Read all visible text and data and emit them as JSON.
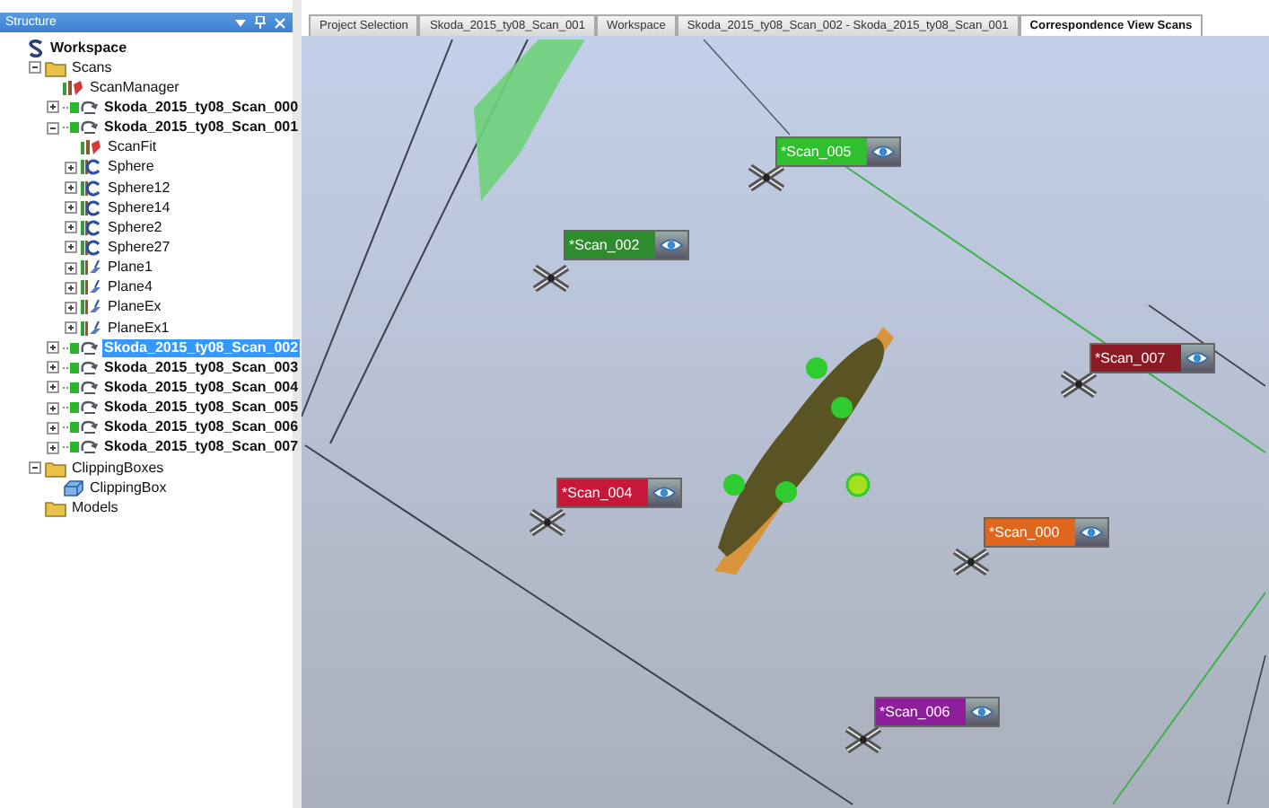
{
  "panel": {
    "title": "Structure"
  },
  "tree": [
    {
      "label": "Workspace",
      "kind": "workspace",
      "selected": false,
      "children": [
        {
          "label": "Scans",
          "kind": "folder",
          "expanded": true,
          "selected": false,
          "children": [
            {
              "label": "ScanManager",
              "kind": "manager",
              "selected": false
            },
            {
              "label": "Skoda_2015_ty08_Scan_000",
              "kind": "scan",
              "expanded": false,
              "selected": false
            },
            {
              "label": "Skoda_2015_ty08_Scan_001",
              "kind": "scan",
              "expanded": true,
              "selected": false,
              "children": [
                {
                  "label": "ScanFit",
                  "kind": "manager",
                  "selected": false
                },
                {
                  "label": "Sphere",
                  "kind": "sphere",
                  "expanded": false,
                  "selected": false
                },
                {
                  "label": "Sphere12",
                  "kind": "sphere",
                  "expanded": false,
                  "selected": false
                },
                {
                  "label": "Sphere14",
                  "kind": "sphere",
                  "expanded": false,
                  "selected": false
                },
                {
                  "label": "Sphere2",
                  "kind": "sphere",
                  "expanded": false,
                  "selected": false
                },
                {
                  "label": "Sphere27",
                  "kind": "sphere",
                  "expanded": false,
                  "selected": false
                },
                {
                  "label": "Plane1",
                  "kind": "plane",
                  "expanded": false,
                  "selected": false
                },
                {
                  "label": "Plane4",
                  "kind": "plane",
                  "expanded": false,
                  "selected": false
                },
                {
                  "label": "PlaneEx",
                  "kind": "plane",
                  "expanded": false,
                  "selected": false
                },
                {
                  "label": "PlaneEx1",
                  "kind": "plane",
                  "expanded": false,
                  "selected": false
                }
              ]
            },
            {
              "label": "Skoda_2015_ty08_Scan_002",
              "kind": "scan",
              "expanded": false,
              "selected": true
            },
            {
              "label": "Skoda_2015_ty08_Scan_003",
              "kind": "scan",
              "expanded": false,
              "selected": false
            },
            {
              "label": "Skoda_2015_ty08_Scan_004",
              "kind": "scan",
              "expanded": false,
              "selected": false
            },
            {
              "label": "Skoda_2015_ty08_Scan_005",
              "kind": "scan",
              "expanded": false,
              "selected": false
            },
            {
              "label": "Skoda_2015_ty08_Scan_006",
              "kind": "scan",
              "expanded": false,
              "selected": false
            },
            {
              "label": "Skoda_2015_ty08_Scan_007",
              "kind": "scan",
              "expanded": false,
              "selected": false
            }
          ]
        },
        {
          "label": "ClippingBoxes",
          "kind": "folder",
          "expanded": true,
          "selected": false,
          "children": [
            {
              "label": "ClippingBox",
              "kind": "clipbox",
              "selected": false
            }
          ]
        },
        {
          "label": "Models",
          "kind": "folder",
          "selected": false
        }
      ]
    }
  ],
  "tabs": [
    {
      "label": "Project Selection",
      "selected": false
    },
    {
      "label": "Skoda_2015_ty08_Scan_001",
      "selected": false
    },
    {
      "label": "Workspace",
      "selected": false
    },
    {
      "label": "Skoda_2015_ty08_Scan_002 - Skoda_2015_ty08_Scan_001",
      "selected": false
    },
    {
      "label": "Correspondence View Scans",
      "selected": true
    }
  ],
  "scan_labels": [
    {
      "text": "*Scan_005",
      "color": "#2fbf2f"
    },
    {
      "text": "*Scan_002",
      "color": "#2e8b2e"
    },
    {
      "text": "*Scan_007",
      "color": "#8b1a24"
    },
    {
      "text": "*Scan_004",
      "color": "#c8183a"
    },
    {
      "text": "*Scan_000",
      "color": "#e0661e"
    },
    {
      "text": "*Scan_006",
      "color": "#8e1f9a"
    }
  ]
}
